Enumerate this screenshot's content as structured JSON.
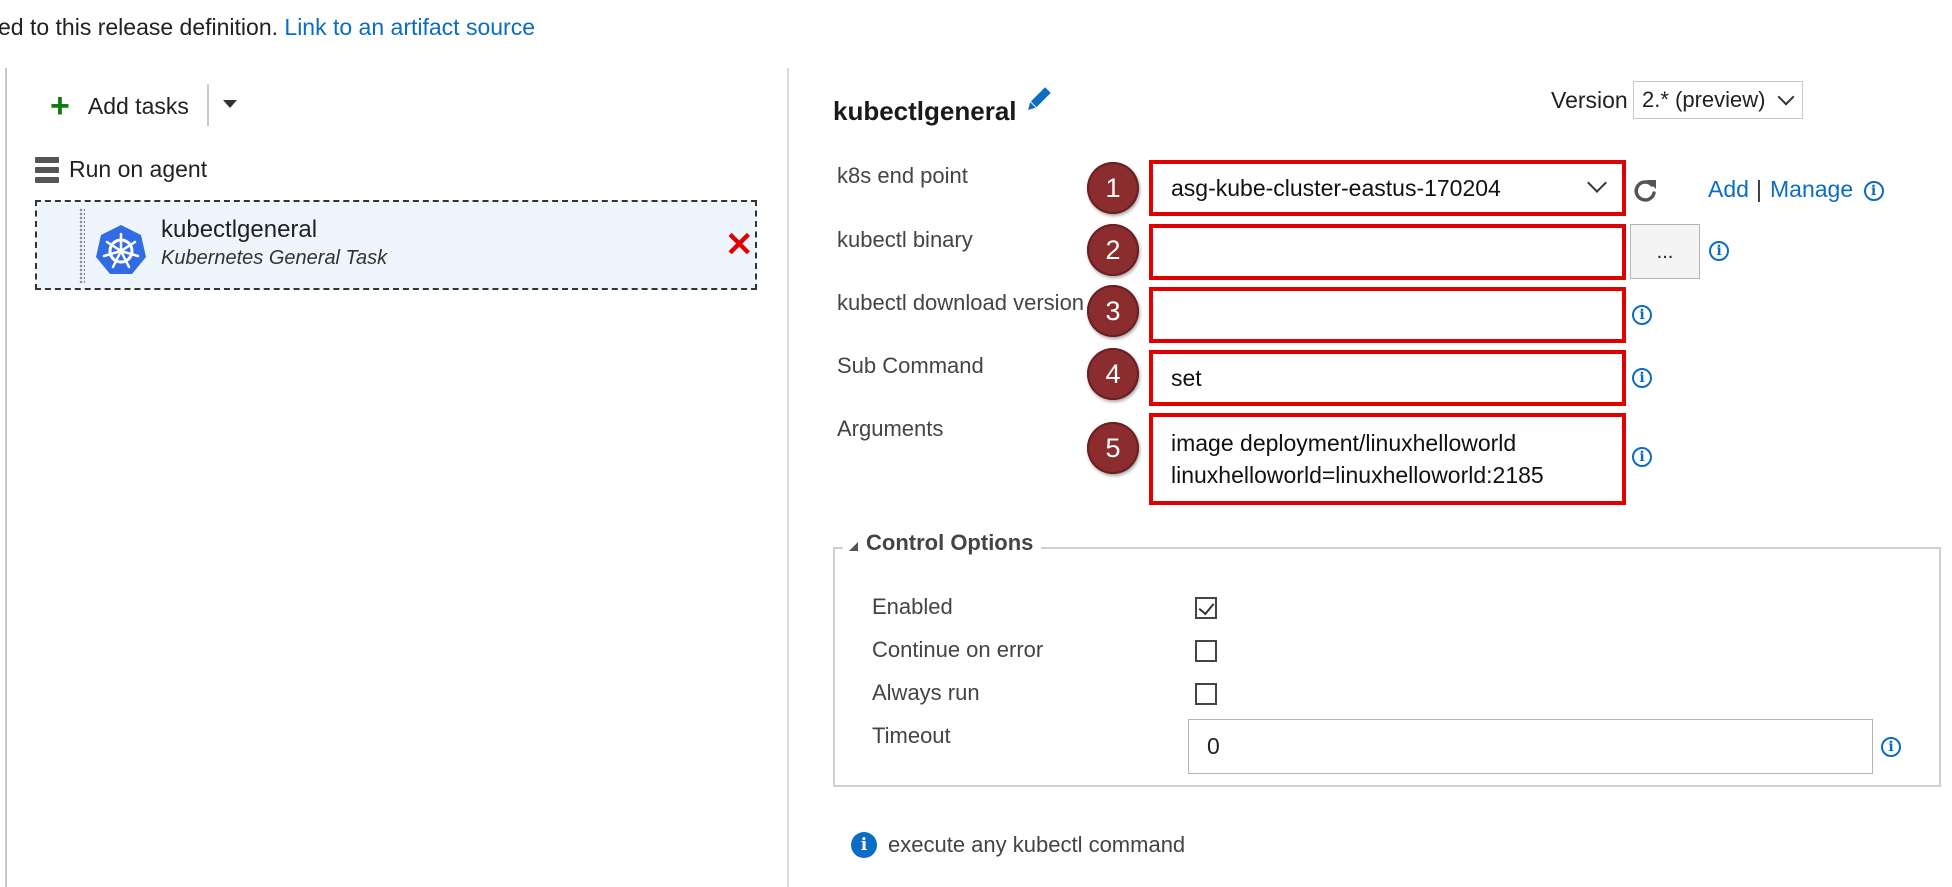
{
  "top": {
    "text": "ed to this release definition. ",
    "link": "Link to an artifact source"
  },
  "left_panel": {
    "add_tasks_label": "Add tasks",
    "phase_label": "Run on agent",
    "task": {
      "name": "kubectlgeneral",
      "subtitle": "Kubernetes General Task"
    }
  },
  "editor": {
    "title": "kubectlgeneral",
    "version_label": "Version",
    "version_value": "2.* (preview)",
    "fields": {
      "endpoint": {
        "label": "k8s end point",
        "value": "asg-kube-cluster-eastus-170204",
        "badge": "1"
      },
      "binary": {
        "label": "kubectl binary",
        "value": "",
        "badge": "2"
      },
      "download_version": {
        "label": "kubectl download version",
        "value": "",
        "badge": "3"
      },
      "sub_command": {
        "label": "Sub Command",
        "value": "set",
        "badge": "4"
      },
      "arguments": {
        "label": "Arguments",
        "value": "image deployment/linuxhelloworld\nlinuxhelloworld=linuxhelloworld:2185",
        "badge": "5"
      }
    },
    "endpoint_add": "Add",
    "endpoint_separator": "|",
    "endpoint_manage": "Manage",
    "browse_label": "...",
    "control_options": {
      "title": "Control Options",
      "enabled_label": "Enabled",
      "enabled": true,
      "continue_on_error_label": "Continue on error",
      "continue_on_error": false,
      "always_run_label": "Always run",
      "always_run": false,
      "timeout_label": "Timeout",
      "timeout_value": "0"
    },
    "description": "execute any kubectl command"
  },
  "icons": {
    "add": "plus-icon",
    "dropdown": "caret-down-icon",
    "phase": "server-icon",
    "task": "kubernetes-icon",
    "delete": "close-icon",
    "edit": "pencil-icon",
    "refresh": "refresh-icon",
    "info": "info-icon"
  },
  "colors": {
    "link": "#0b6cc3",
    "annotation_box": "#e00000",
    "badge": "#8b2c2f",
    "selected_task_bg": "#eef5fc",
    "delete": "#e00000",
    "kubernetes": "#326ce5"
  }
}
